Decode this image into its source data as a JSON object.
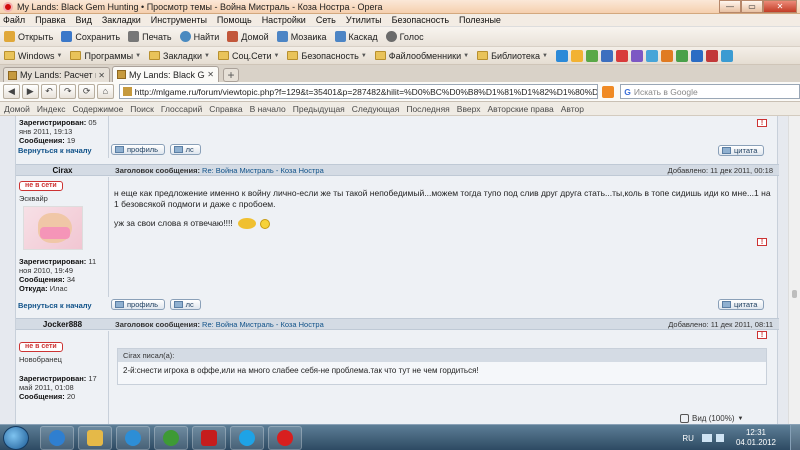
{
  "window": {
    "title": "My Lands: Black Gem Hunting • Просмотр темы - Война Мистраль - Коза Ностра - Opera",
    "minimize": "—",
    "maximize": "▭",
    "close": "✕"
  },
  "menu": [
    "Файл",
    "Правка",
    "Вид",
    "Закладки",
    "Инструменты",
    "Помощь",
    "Настройки",
    "Сеть",
    "Утилиты",
    "Безопасность",
    "Полезные"
  ],
  "toolbar": [
    {
      "label": "Открыть",
      "icon": "open-icon",
      "color": "#e0a83a"
    },
    {
      "label": "Сохранить",
      "icon": "save-icon",
      "color": "#3b78c9"
    },
    {
      "label": "Печать",
      "icon": "print-icon",
      "color": "#777777"
    },
    {
      "label": "Найти",
      "icon": "find-icon",
      "color": "#4a8ac0"
    },
    {
      "label": "Домой",
      "icon": "home-icon",
      "color": "#c2573b"
    },
    {
      "label": "Мозаика",
      "icon": "tile-icon",
      "color": "#4d85c5"
    },
    {
      "label": "Каскад",
      "icon": "cascade-icon",
      "color": "#4d85c5"
    },
    {
      "label": "Голос",
      "icon": "voice-icon",
      "color": "#6b6b6b"
    }
  ],
  "bookmarks": [
    {
      "label": "Windows"
    },
    {
      "label": "Программы"
    },
    {
      "label": "Закладки"
    },
    {
      "label": "Соц.Сети"
    },
    {
      "label": "Безопасность"
    },
    {
      "label": "Файлообменники"
    },
    {
      "label": "Библиотека"
    }
  ],
  "bookmark_icons": [
    "#2c8ad8",
    "#f2b233",
    "#5aa847",
    "#3d6fbf",
    "#d83b3b",
    "#7c58c4",
    "#47a5d8",
    "#e07b22",
    "#49a04a",
    "#2b6cc4",
    "#c23939",
    "#3b9bd2",
    "#888888"
  ],
  "tabs": [
    {
      "label": "My Lands: Расчет цены...",
      "active": false
    },
    {
      "label": "My Lands: Black Gem ...",
      "active": true
    }
  ],
  "address": {
    "url": "http://mlgame.ru/forum/viewtopic.php?f=129&t=35401&p=287482&hilit=%D0%BC%D0%B8%D1%81%D1%82%D1%80%D0%B0%D0%BB%D1%8C#",
    "search_placeholder": "Искать в Google"
  },
  "navlinks": [
    "Домой",
    "Индекс",
    "Содержимое",
    "Поиск",
    "Глоссарий",
    "Справка",
    "В начало",
    "Предыдущая",
    "Следующая",
    "Последняя",
    "Вверх",
    "Авторские права",
    "Автор"
  ],
  "post0": {
    "registered_label": "Зарегистрирован:",
    "registered": "05 янв 2011, 19:13",
    "messages_label": "Сообщения:",
    "messages": "19",
    "back": "Вернуться к началу",
    "profile": "профиль",
    "pm": "лс"
  },
  "post1": {
    "author": "Cirax",
    "subject_label": "Заголовок сообщения:",
    "subject": "Re: Война Мистраль - Коза Ностра",
    "posted": "Добавлено: 11 дек 2011, 00:18",
    "online": "не в сети",
    "rank": "Эсквайр",
    "registered_label": "Зарегистрирован:",
    "registered": "11 ноя 2010, 19:49",
    "messages_label": "Сообщения:",
    "messages": "34",
    "from_label": "Откуда:",
    "from": "Илас",
    "text1": "н еще как предложение именно к войну лично-если же ты такой непобедимый...можем тогда тупо под слив друг друга стать...ты,коль в топе сидишь иди ко мне...1 на 1 безовсякой подмоги и даже с пробоем.",
    "text2": "уж за свои слова я отвечаю!!!!",
    "back": "Вернуться к началу",
    "profile": "профиль",
    "pm": "лс",
    "quote": "цитата"
  },
  "post2": {
    "author": "Jocker888",
    "subject_label": "Заголовок сообщения:",
    "subject": "Re: Война Мистраль - Коза Ностра",
    "posted": "Добавлено: 11 дек 2011, 08:11",
    "online": "не в сети",
    "rank": "Новобранец",
    "registered_label": "Зарегистрирован:",
    "registered": "17 май 2011, 01:08",
    "messages_label": "Сообщения:",
    "messages": "20",
    "quote_header": "Cirax писал(а):",
    "quote_text": "2-й:снести игрока в оффе,или на много слабее себя-не проблема.так что тут не чем гордиться!",
    "quote": "цитата"
  },
  "top_quote": "цитата",
  "zoom": "Вид (100%)",
  "taskbar": {
    "lang": "RU",
    "time": "12:31",
    "date": "04.01.2012",
    "apps": [
      {
        "name": "ie-icon",
        "color": "#2f7fd0"
      },
      {
        "name": "explorer-icon",
        "color": "#e5b948"
      },
      {
        "name": "player-icon",
        "color": "#2d8ed6"
      },
      {
        "name": "winamp-icon",
        "color": "#3e9a35"
      },
      {
        "name": "opera-taskbar-icon",
        "color": "#c51d1d"
      },
      {
        "name": "skype-icon",
        "color": "#1ea3e6"
      },
      {
        "name": "opera-icon",
        "color": "#d81f1f"
      }
    ]
  }
}
